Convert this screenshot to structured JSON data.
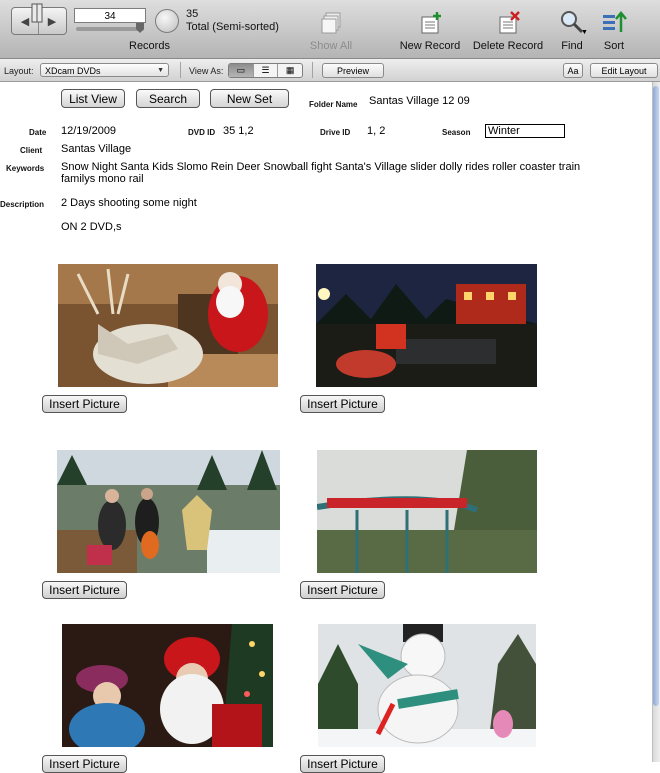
{
  "toolbar": {
    "record_number": "34",
    "records_label": "Records",
    "found_count": "35",
    "found_status": "Total (Semi-sorted)",
    "show_all": "Show All",
    "new_record": "New Record",
    "delete_record": "Delete Record",
    "find": "Find",
    "sort": "Sort"
  },
  "layoutbar": {
    "layout_label": "Layout:",
    "layout_value": "XDcam DVDs",
    "view_as_label": "View As:",
    "preview": "Preview",
    "font_size_button": "Aa",
    "edit_layout": "Edit Layout"
  },
  "buttons": {
    "list_view": "List View",
    "search": "Search",
    "new_set": "New Set",
    "insert_picture": "Insert Picture"
  },
  "record": {
    "folder_name_label": "Folder Name",
    "folder_name": "Santas Village 12 09",
    "date_label": "Date",
    "date": "12/19/2009",
    "dvd_id_label": "DVD ID",
    "dvd_id": "35 1,2",
    "drive_id_label": "Drive ID",
    "drive_id": "1, 2",
    "season_label": "Season",
    "season": "Winter",
    "client_label": "Client",
    "client": "Santas Village",
    "keywords_label": "Keywords",
    "keywords": "Snow Night  Santa Kids Slomo Rein Deer Snowball fight Santa's Village slider dolly rides roller coaster train familys mono rail",
    "description_label": "Description",
    "description": "2 Days shooting some night",
    "description_extra": "ON 2 DVD,s"
  },
  "colors": {
    "toolbar_top": "#dedede",
    "toolbar_bottom": "#b4b4b4",
    "scroll_accent": "#8ea9d4"
  }
}
